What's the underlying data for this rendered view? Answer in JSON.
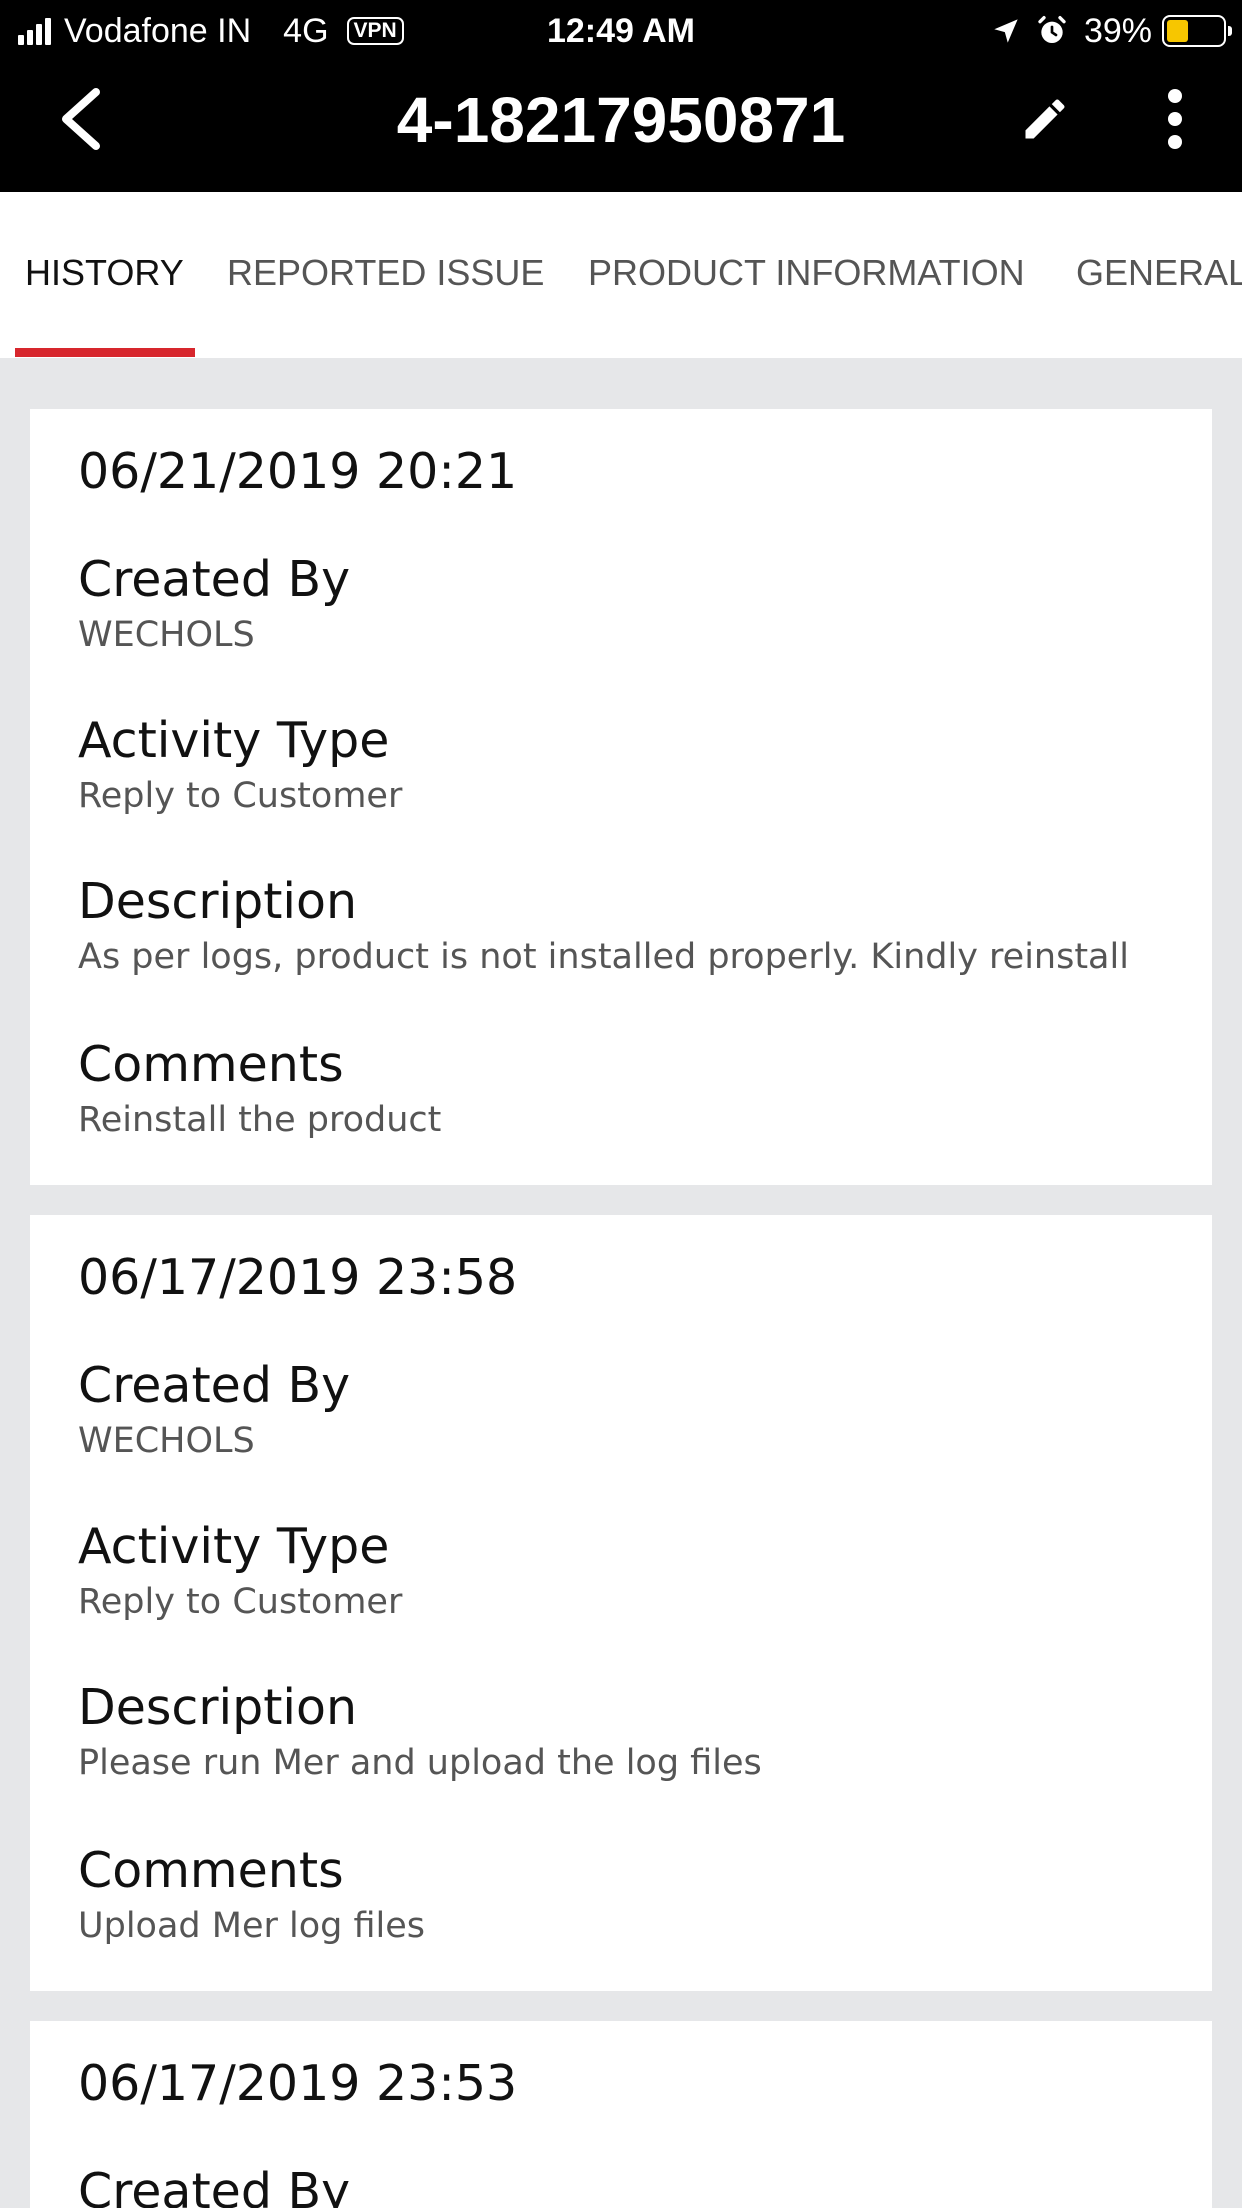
{
  "status_bar": {
    "carrier": "Vodafone IN",
    "network": "4G",
    "vpn": "VPN",
    "time": "12:49 AM",
    "battery_percent": "39%",
    "battery_level": 0.39,
    "battery_color": "#f7c600"
  },
  "header": {
    "title": "4-18217950871",
    "back_icon": "chevron-left-icon",
    "edit_icon": "pencil-icon",
    "more_icon": "more-vertical-icon"
  },
  "tabs": [
    {
      "label": "HISTORY",
      "active": true
    },
    {
      "label": "REPORTED ISSUE",
      "active": false
    },
    {
      "label": "PRODUCT INFORMATION",
      "active": false
    },
    {
      "label": "GENERAL",
      "active": false
    }
  ],
  "accent_color": "#d7262d",
  "history": [
    {
      "date": "06/21/2019 20:21",
      "fields": [
        {
          "label": "Created By",
          "value": "WECHOLS"
        },
        {
          "label": "Activity Type",
          "value": "Reply to Customer"
        },
        {
          "label": "Description",
          "value": "As per logs, product is not installed properly. Kindly reinstall"
        },
        {
          "label": "Comments",
          "value": "Reinstall the product"
        }
      ]
    },
    {
      "date": "06/17/2019 23:58",
      "fields": [
        {
          "label": "Created By",
          "value": "WECHOLS"
        },
        {
          "label": "Activity Type",
          "value": "Reply to Customer"
        },
        {
          "label": "Description",
          "value": "Please run Mer and upload the log files"
        },
        {
          "label": "Comments",
          "value": "Upload Mer log files"
        }
      ]
    },
    {
      "date": "06/17/2019 23:53",
      "fields": [
        {
          "label": "Created By",
          "value": ""
        }
      ]
    }
  ]
}
